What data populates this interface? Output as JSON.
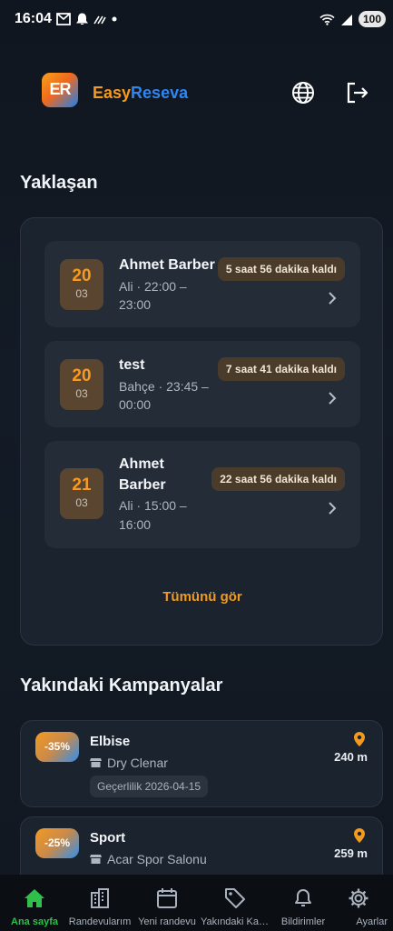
{
  "status_bar": {
    "time": "16:04",
    "battery": "100"
  },
  "header": {
    "logo_text": "ER",
    "brand_part1": "Easy",
    "brand_part2": "Reseva",
    "globe_icon": "globe-icon",
    "logout_icon": "logout-icon"
  },
  "upcoming": {
    "title": "Yaklaşan",
    "items": [
      {
        "day": "20",
        "month": "03",
        "title": "Ahmet Barber",
        "sub_line1": "Ali · 22:00 –",
        "sub_line2": "23:00",
        "remaining": "5 saat 56 dakika kaldı"
      },
      {
        "day": "20",
        "month": "03",
        "title": "test",
        "sub_line1": "Bahçe · 23:45 –",
        "sub_line2": "00:00",
        "remaining": "7 saat 41 dakika kaldı"
      },
      {
        "day": "21",
        "month": "03",
        "title_line1": "Ahmet",
        "title_line2": "Barber",
        "sub_line1": "Ali · 15:00 –",
        "sub_line2": "16:00",
        "remaining": "22 saat 56 dakika kaldı"
      }
    ],
    "see_all": "Tümünü gör"
  },
  "campaigns": {
    "title": "Yakındaki Kampanyalar",
    "items": [
      {
        "discount": "-35%",
        "title": "Elbise",
        "shop": "Dry Clenar",
        "validity": "Geçerlilik 2026-04-15",
        "distance": "240 m"
      },
      {
        "discount": "-25%",
        "title": "Sport",
        "shop": "Acar Spor Salonu",
        "distance": "259 m"
      }
    ]
  },
  "nav": {
    "items": [
      {
        "label": "Ana sayfa",
        "icon": "home-icon"
      },
      {
        "label": "Randevularım",
        "icon": "building-icon"
      },
      {
        "label": "Yeni randevu",
        "icon": "calendar-icon"
      },
      {
        "label": "Yakındaki Kampanyalar",
        "icon": "tag-icon"
      },
      {
        "label": "Bildirimler",
        "icon": "bell-icon"
      },
      {
        "label": "Ayarlar",
        "icon": "gear-icon"
      }
    ]
  },
  "colors": {
    "accent": "#f39a1f",
    "brand_blue": "#2f86f0",
    "active_nav": "#2fbf4a"
  }
}
